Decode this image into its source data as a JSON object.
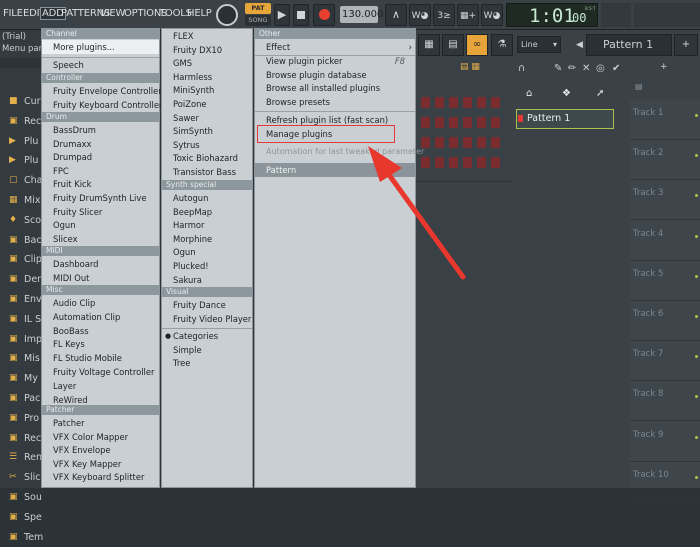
{
  "menubar": {
    "items": [
      "FILE",
      "EDIT",
      "ADD",
      "PATTERNS",
      "VIEW",
      "OPTIONS",
      "TOOLS",
      "HELP"
    ],
    "pat_label": "PAT",
    "song_label": "SONG",
    "tempo": "130.000",
    "time": "1:01",
    "time_small": "00",
    "time_mode": "B:S:T"
  },
  "toolbar2": {
    "snap": "Line",
    "pattern_selector": "Pattern 1"
  },
  "browser": {
    "trial": "(Trial)",
    "menu_param": "Menu parameters",
    "items": [
      "Cur",
      "Rec",
      "Plu",
      "Plu",
      "Cha",
      "Mix",
      "Sco",
      "Bac",
      "Clip",
      "Der",
      "Env",
      "IL S",
      "Imp",
      "Mis",
      "My",
      "Pac",
      "Pro",
      "Rec",
      "Ren",
      "Slic",
      "Sou",
      "Spe",
      "Tem"
    ]
  },
  "menu1": {
    "headers": {
      "channel": "Channel",
      "controller": "Controller",
      "drum": "Drum",
      "midi": "MIDI",
      "misc": "Misc",
      "patcher": "Patcher"
    },
    "more_plugins": "More plugins...",
    "speech": "Speech",
    "controller_items": [
      "Fruity Envelope Controller",
      "Fruity Keyboard Controller"
    ],
    "drum_items": [
      "BassDrum",
      "Drumaxx",
      "Drumpad",
      "FPC",
      "Fruit Kick",
      "Fruity DrumSynth Live",
      "Fruity Slicer",
      "Ogun",
      "Slicex"
    ],
    "midi_items": [
      "Dashboard",
      "MIDI Out"
    ],
    "misc_items": [
      "Audio Clip",
      "Automation Clip",
      "BooBass",
      "FL Keys",
      "FL Studio Mobile",
      "Fruity Voltage Controller",
      "Layer",
      "ReWired"
    ],
    "patcher_items": [
      "Patcher",
      "VFX Color Mapper",
      "VFX Envelope",
      "VFX Key Mapper",
      "VFX Keyboard Splitter"
    ]
  },
  "menu2": {
    "synth_items": [
      "FLEX",
      "Fruity DX10",
      "GMS",
      "Harmless",
      "MiniSynth",
      "PoiZone",
      "Sawer",
      "SimSynth",
      "Sytrus",
      "Toxic Biohazard",
      "Transistor Bass"
    ],
    "synth_special_header": "Synth special",
    "synth_special_items": [
      "Autogun",
      "BeepMap",
      "Harmor",
      "Morphine",
      "Ogun",
      "Plucked!",
      "Sakura"
    ],
    "visual_header": "Visual",
    "visual_items": [
      "Fruity Dance",
      "Fruity Video Player"
    ],
    "view_modes": [
      "Categories",
      "Simple",
      "Tree"
    ]
  },
  "menu3": {
    "other_header": "Other",
    "effect": "Effect",
    "plugin_picker": "View plugin picker",
    "plugin_picker_key": "F8",
    "browse_db": "Browse plugin database",
    "browse_installed": "Browse all installed plugins",
    "browse_presets": "Browse presets",
    "refresh": "Refresh plugin list (fast scan)",
    "manage": "Manage plugins",
    "automation": "Automation for last tweaked parameter",
    "pattern": "Pattern"
  },
  "playlist": {
    "pattern_item": "Pattern 1",
    "tracks": [
      "Track 1",
      "Track 2",
      "Track 3",
      "Track 4",
      "Track 5",
      "Track 6",
      "Track 7",
      "Track 8",
      "Track 9",
      "Track 10"
    ]
  },
  "colors": {
    "highlight_box": "#e53935",
    "arrow": "#e8372d",
    "menu_bg": "#c9cfd3",
    "header_bg": "#8d979e"
  }
}
